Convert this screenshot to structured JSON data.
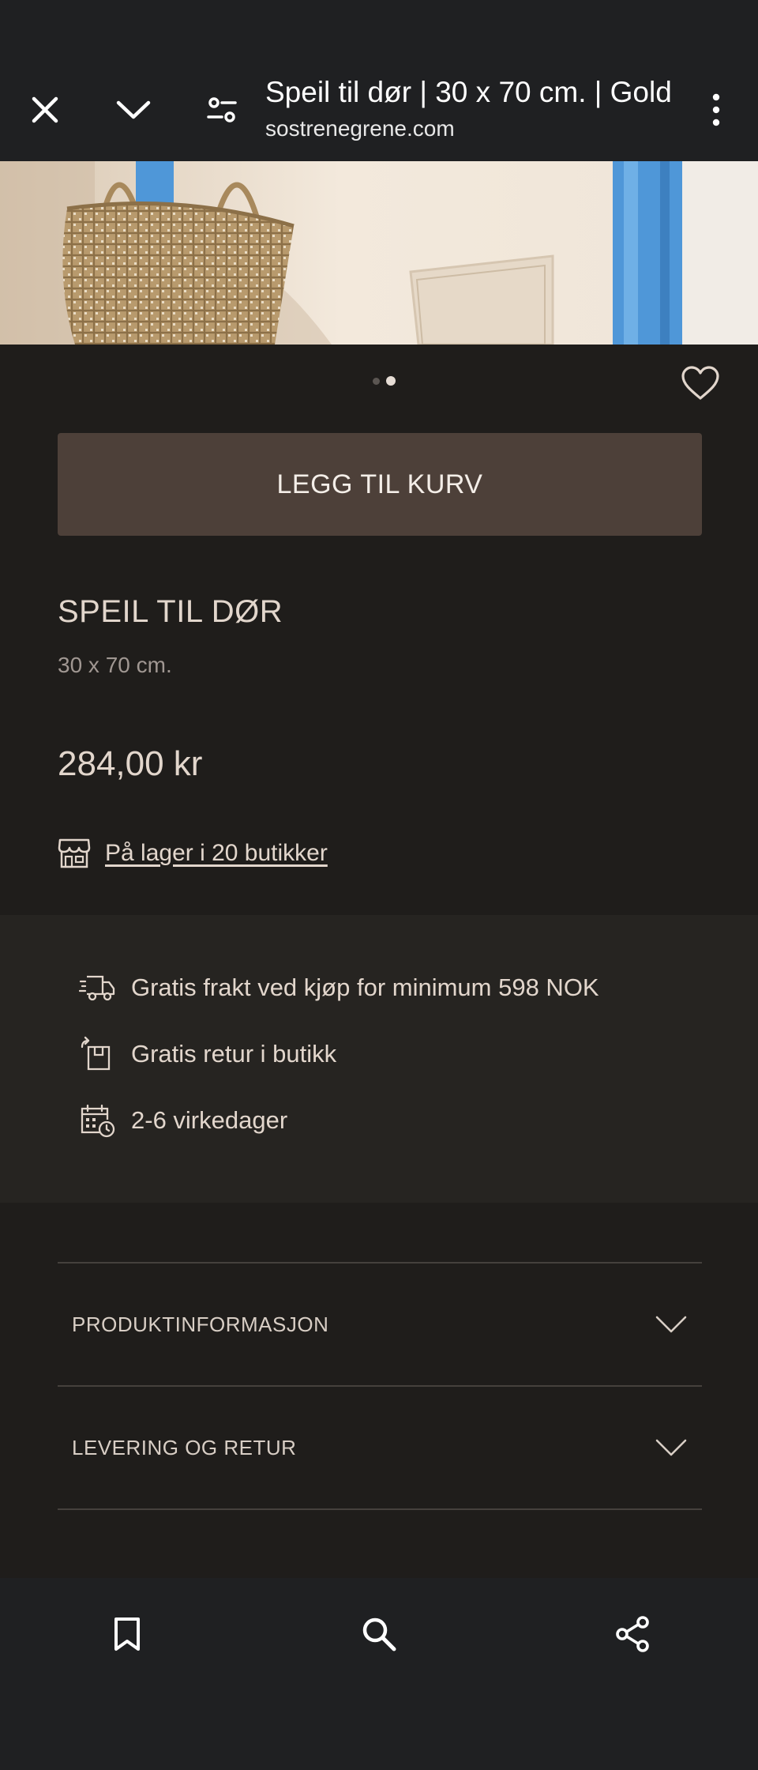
{
  "browser": {
    "title": "Speil til dør | 30 x 70 cm. | Gold",
    "url": "sostrenegrene.com",
    "icons": {
      "close": "close-icon",
      "collapse": "chevron-down-icon",
      "customize": "tune-icon",
      "menu": "more-vert-icon"
    }
  },
  "carousel": {
    "page_count": 2,
    "active_index": 2
  },
  "product": {
    "add_to_cart_label": "LEGG TIL KURV",
    "name": "SPEIL TIL DØR",
    "size": "30 x 70 cm.",
    "price": "284,00 kr",
    "stock_link": "På lager i 20 butikker"
  },
  "benefits": [
    {
      "icon": "delivery-truck-icon",
      "text": "Gratis frakt ved kjøp for minimum 598 NOK"
    },
    {
      "icon": "return-box-icon",
      "text": "Gratis retur i butikk"
    },
    {
      "icon": "calendar-clock-icon",
      "text": "2-6 virkedager"
    }
  ],
  "accordion": [
    {
      "label": "PRODUKTINFORMASJON"
    },
    {
      "label": "LEVERING OG RETUR"
    }
  ],
  "bottom_bar": {
    "icons": [
      "bookmark-icon",
      "search-icon",
      "share-icon"
    ]
  },
  "colors": {
    "page_background": "#1f1d1b",
    "browser_chrome": "#1f2022",
    "cart_button": "#4d4039",
    "benefits_background": "#262421",
    "text_primary": "#e2d6cc",
    "text_secondary": "#a09792",
    "hero_frame_blue": "#4f97d8"
  }
}
